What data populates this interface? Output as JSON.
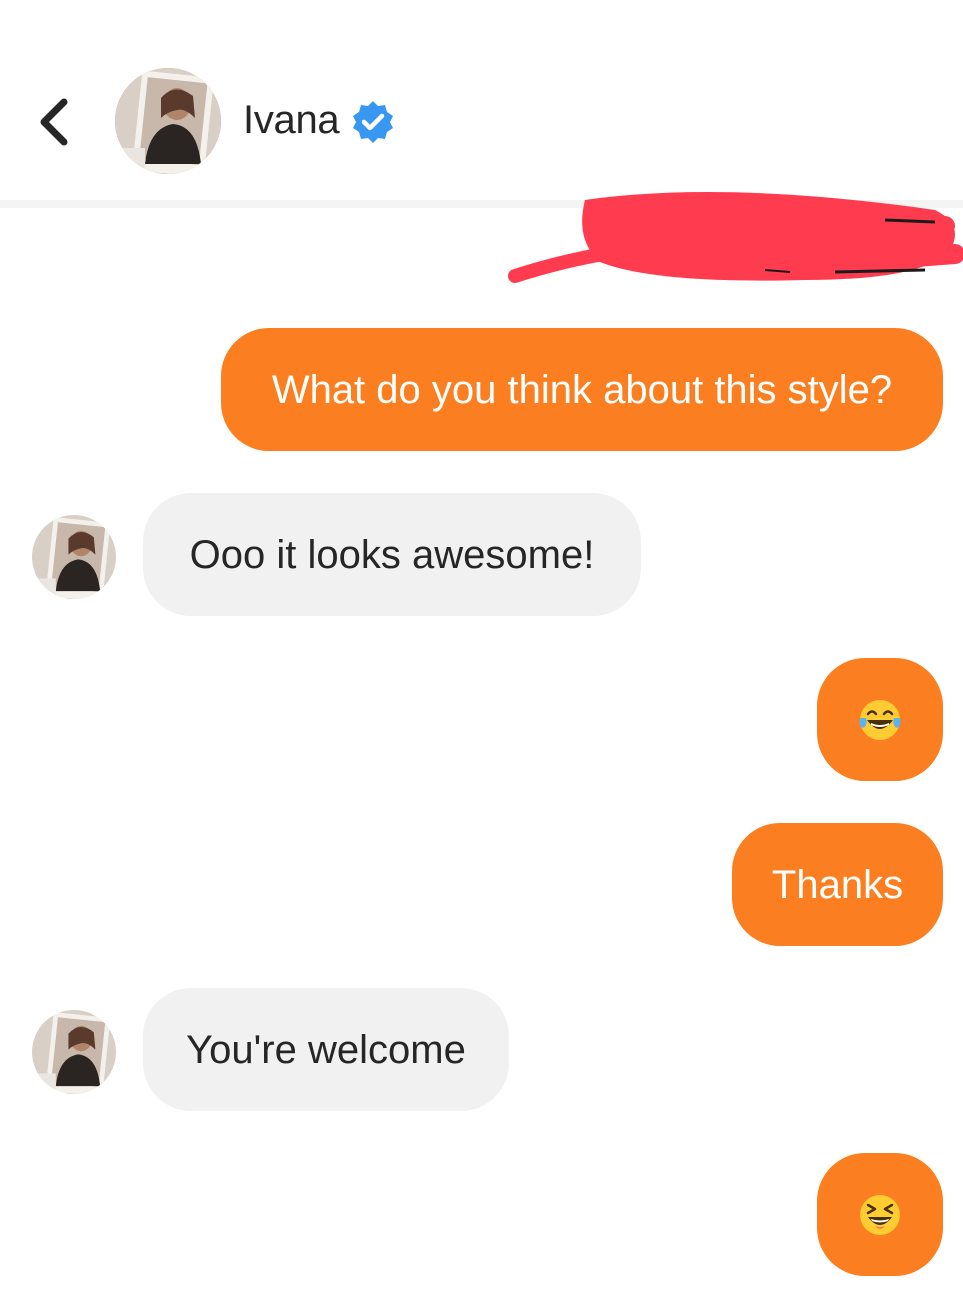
{
  "header": {
    "contact_name": "Ivana",
    "verified": true,
    "back_icon": "chevron-left-icon",
    "verified_icon": "verified-badge-icon"
  },
  "messages": [
    {
      "direction": "sent",
      "text": "What do you think about this style?"
    },
    {
      "direction": "received",
      "text": "Ooo it looks awesome!"
    },
    {
      "direction": "sent",
      "text": "😂",
      "emoji_name": "face-with-tears-of-joy"
    },
    {
      "direction": "sent",
      "text": "Thanks"
    },
    {
      "direction": "received",
      "text": "You're welcome"
    },
    {
      "direction": "sent",
      "text": "😆",
      "emoji_name": "grinning-squinting-face"
    }
  ],
  "colors": {
    "sent_bubble": "#fb7f21",
    "received_bubble": "#f1f1f1",
    "verified_blue": "#3897f0",
    "redaction_red": "#ff3c4f"
  }
}
